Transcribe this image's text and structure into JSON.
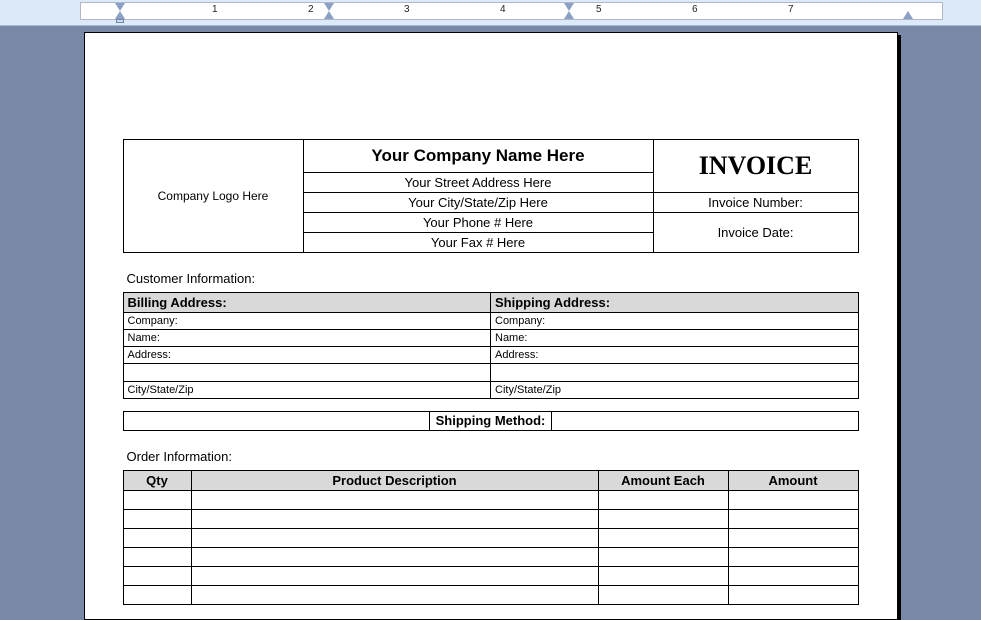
{
  "header": {
    "logo_placeholder": "Company Logo Here",
    "company_name": "Your Company Name Here",
    "street": "Your Street Address Here",
    "city_state_zip": "Your City/State/Zip Here",
    "phone": "Your Phone # Here",
    "fax": "Your Fax # Here",
    "invoice_title": "INVOICE",
    "invoice_number_label": "Invoice Number:",
    "invoice_date_label": "Invoice Date:"
  },
  "customer": {
    "section_label": "Customer Information:",
    "billing_header": "Billing Address:",
    "shipping_header": "Shipping Address:",
    "fields": {
      "company": "Company:",
      "name": "Name:",
      "address": "Address:",
      "city_state_zip": "City/State/Zip"
    }
  },
  "shipping_method": {
    "label": "Shipping Method:"
  },
  "order": {
    "section_label": "Order Information:",
    "columns": {
      "qty": "Qty",
      "description": "Product Description",
      "each": "Amount Each",
      "amount": "Amount"
    }
  },
  "ruler": {
    "numbers": [
      1,
      2,
      3,
      4,
      5,
      6,
      7
    ]
  }
}
